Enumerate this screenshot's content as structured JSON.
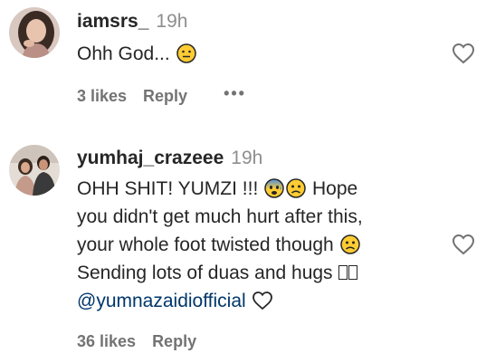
{
  "comments": [
    {
      "username": "iamsrs_",
      "time": "19h",
      "text": "Ohh God...",
      "emojis": [
        "neutral-face-emoji"
      ],
      "likes": "3 likes",
      "reply": "Reply",
      "more": "•••"
    },
    {
      "username": "yumhaj_crazeee",
      "time": "19h",
      "line1": "OHH SHIT! YUMZI !!!",
      "line1_tail": "Hope",
      "line2": "you didn't get much hurt after this,",
      "line3": "your whole foot twisted though",
      "line4": "Sending lots of duas and hugs",
      "mention": "@yumnazaidiofficial",
      "emojis": [
        "anxious-face-emoji",
        "slightly-frowning-face-emoji"
      ],
      "likes": "36 likes",
      "reply": "Reply"
    }
  ],
  "colors": {
    "text": "#262626",
    "muted": "#737373",
    "time": "#8e8e8e",
    "mention": "#00376b"
  }
}
